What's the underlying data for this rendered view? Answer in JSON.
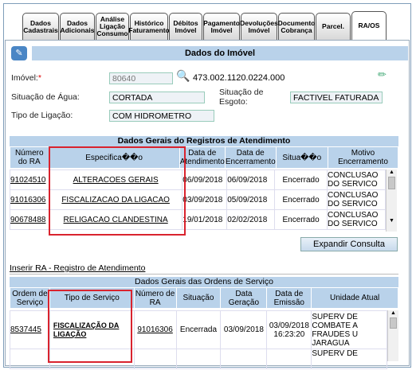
{
  "tabs": [
    {
      "label": "Dados Cadastrais"
    },
    {
      "label": "Dados Adicionais"
    },
    {
      "label": "Análise Ligação Consumo"
    },
    {
      "label": "Histórico Faturamento"
    },
    {
      "label": "Débitos Imóvel"
    },
    {
      "label": "Pagamento Imóvel"
    },
    {
      "label": "Devoluções Imóvel"
    },
    {
      "label": "Documento Cobrança"
    },
    {
      "label": "Parcel."
    },
    {
      "label": "RA/OS"
    }
  ],
  "imovel_section": {
    "title": "Dados do Imóvel",
    "imovel_label": "Imóvel:",
    "required_mark": "*",
    "imovel_value": "80640",
    "imovel_inscricao": "473.002.1120.0224.000",
    "agua_label": "Situação de Água:",
    "agua_value": "CORTADA",
    "esgoto_label": "Situação de Esgoto:",
    "esgoto_value": "FACTIVEL FATURADA",
    "ligacao_label": "Tipo de Ligação:",
    "ligacao_value": "COM HIDROMETRO"
  },
  "ra_section": {
    "title": "Dados Gerais do Registros de Atendimento",
    "headers": [
      "Número do RA",
      "Especifica��o",
      "Data de Atendimento",
      "Data de Encerramento",
      "Situa��o",
      "Motivo Encerramento"
    ],
    "rows": [
      {
        "numero": "91024510",
        "especificacao": "ALTERACOES GERAIS",
        "data_atend": "06/09/2018",
        "data_enc": "06/09/2018",
        "situacao": "Encerrado",
        "motivo": "CONCLUSAO DO SERVICO"
      },
      {
        "numero": "91016306",
        "especificacao": "FISCALIZACAO DA LIGACAO",
        "data_atend": "03/09/2018",
        "data_enc": "05/09/2018",
        "situacao": "Encerrado",
        "motivo": "CONCLUSAO DO SERVICO"
      },
      {
        "numero": "90678488",
        "especificacao": "RELIGACAO CLANDESTINA",
        "data_atend": "19/01/2018",
        "data_enc": "02/02/2018",
        "situacao": "Encerrado",
        "motivo": "CONCLUSAO DO SERVICO"
      }
    ],
    "expand_button": "Expandir Consulta"
  },
  "insert_ra_link": "Inserir RA - Registro de Atendimento",
  "os_section": {
    "title": "Dados Gerais das Ordens de Serviço",
    "headers": [
      "Ordem de Serviço",
      "Tipo de Serviço",
      "Número de RA",
      "Situação",
      "Data Geração",
      "Data de Emissão",
      "Unidade Atual"
    ],
    "rows": [
      {
        "ordem": "8537445",
        "tipo": "FISCALIZAÇÃO DA LIGAÇÃO",
        "ra": "91016306",
        "situacao": "Encerrada",
        "geracao": "03/09/2018",
        "emissao": "03/09/2018 16:23:20",
        "unidade": "SUPERV DE COMBATE A FRAUDES U JARAGUA"
      },
      {
        "ordem": "",
        "tipo": "",
        "ra": "",
        "situacao": "",
        "geracao": "",
        "emissao": "",
        "unidade": "SUPERV DE"
      }
    ]
  },
  "colors": {
    "header_bg": "#b9d2ea",
    "highlight_border": "#d9232e",
    "icon_bg": "#4a86c5"
  }
}
